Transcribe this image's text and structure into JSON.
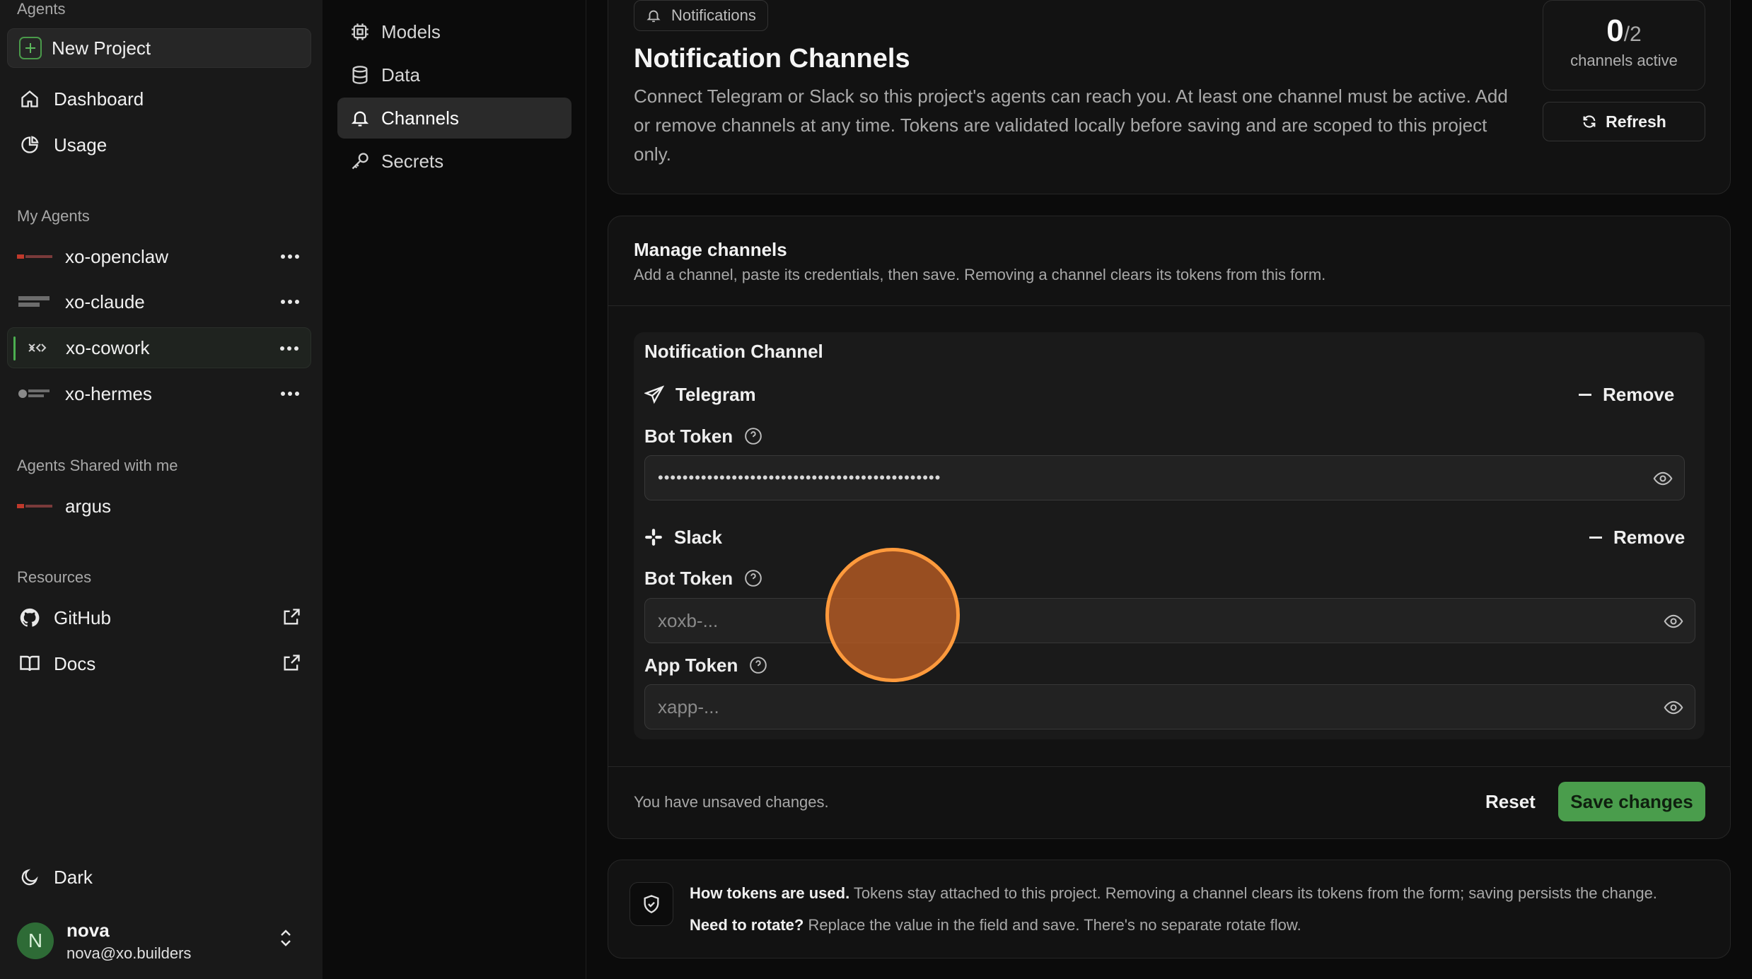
{
  "sidebar": {
    "section_agents": "Agents",
    "new_project": "New Project",
    "nav": [
      {
        "label": "Dashboard",
        "icon": "home-icon"
      },
      {
        "label": "Usage",
        "icon": "pie-chart-icon"
      }
    ],
    "my_agents_label": "My Agents",
    "my_agents": [
      {
        "name": "xo-openclaw",
        "logo": "openclaw-logo"
      },
      {
        "name": "xo-claude",
        "logo": "claude-code-logo"
      },
      {
        "name": "xo-cowork",
        "logo": "cowork-logo",
        "active": true
      },
      {
        "name": "xo-hermes",
        "logo": "hermes-agent-logo"
      }
    ],
    "shared_label": "Agents Shared with me",
    "shared_agents": [
      {
        "name": "argus",
        "logo": "openclaw-logo"
      }
    ],
    "resources_label": "Resources",
    "resources": [
      {
        "label": "GitHub",
        "icon": "github-icon"
      },
      {
        "label": "Docs",
        "icon": "book-icon"
      }
    ],
    "theme_label": "Dark",
    "user": {
      "initial": "N",
      "name": "nova",
      "email": "nova@xo.builders"
    }
  },
  "subnav": [
    {
      "label": "Models",
      "icon": "chip-icon"
    },
    {
      "label": "Data",
      "icon": "database-icon"
    },
    {
      "label": "Channels",
      "icon": "bell-icon",
      "active": true
    },
    {
      "label": "Secrets",
      "icon": "key-icon"
    }
  ],
  "header": {
    "pill": "Notifications",
    "title": "Notification Channels",
    "description": "Connect Telegram or Slack so this project's agents can reach you. At least one channel must be active. Add or remove channels at any time. Tokens are validated locally before saving and are scoped to this project only.",
    "counter_value": "0",
    "counter_total": "/2",
    "counter_label": "channels active",
    "refresh": "Refresh"
  },
  "manage": {
    "title": "Manage channels",
    "subtitle": "Add a channel, paste its credentials, then save. Removing a channel clears its tokens from this form.",
    "group_title": "Notification Channel",
    "telegram": {
      "name": "Telegram",
      "remove": "Remove",
      "bot_token_label": "Bot Token",
      "bot_token_value": "••••••••••••••••••••••••••••••••••••••••••••••"
    },
    "slack": {
      "name": "Slack",
      "remove": "Remove",
      "bot_token_label": "Bot Token",
      "bot_token_placeholder": "xoxb-...",
      "app_token_label": "App Token",
      "app_token_placeholder": "xapp-..."
    },
    "unsaved": "You have unsaved changes.",
    "reset": "Reset",
    "save": "Save changes"
  },
  "info": {
    "line1_bold": "How tokens are used.",
    "line1_text": " Tokens stay attached to this project. Removing a channel clears its tokens from the form; saving persists the change.",
    "line2_bold": "Need to rotate?",
    "line2_text": " Replace the value in the field and save. There's no separate rotate flow."
  },
  "colors": {
    "accent": "#4a9d4c",
    "cursor": "#ff9a3c"
  }
}
